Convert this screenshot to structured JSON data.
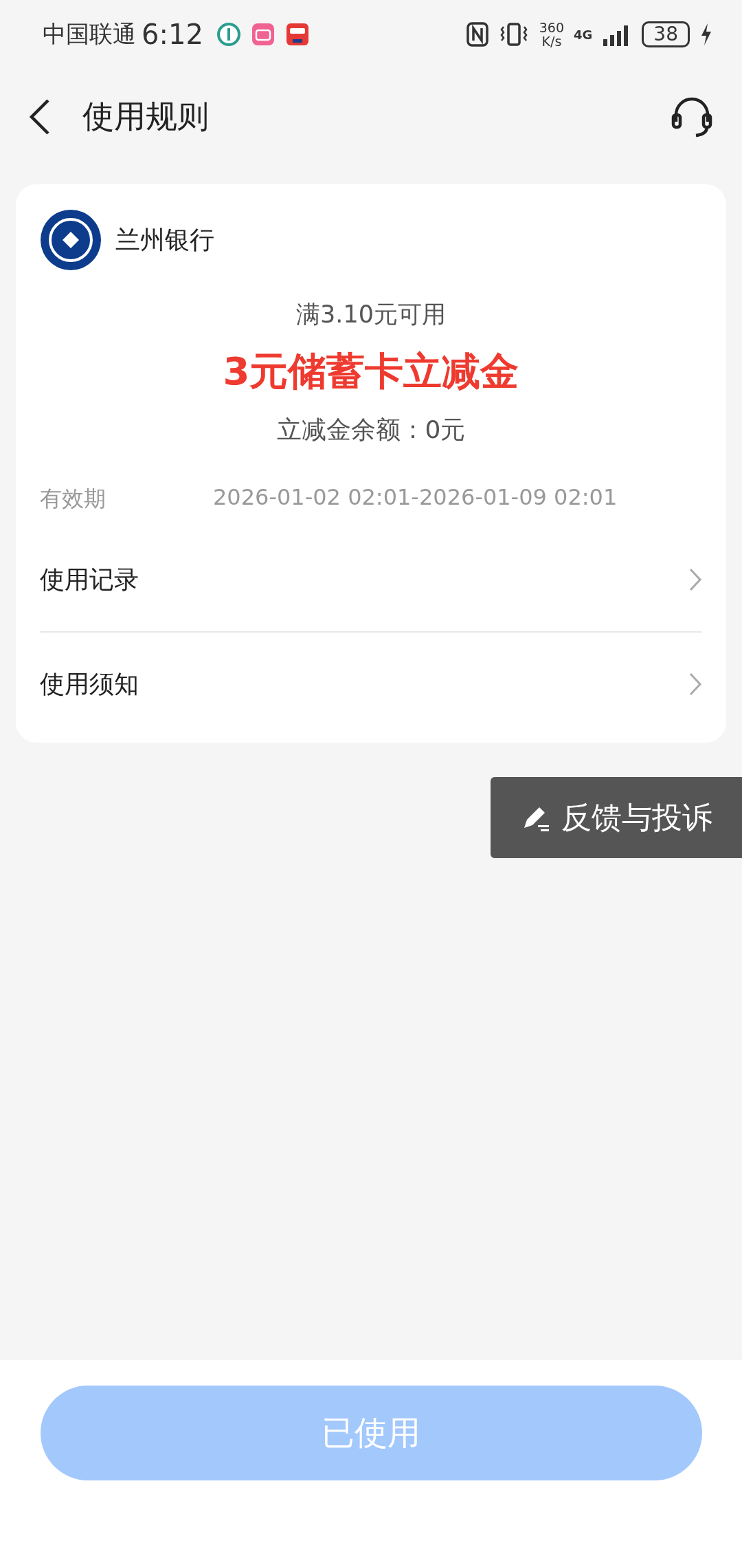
{
  "status_bar": {
    "carrier": "中国联通",
    "time": "6:12",
    "speed_value": "360",
    "speed_unit": "K/s",
    "network": "4G",
    "battery": "38"
  },
  "header": {
    "title": "使用规则"
  },
  "card": {
    "bank_name": "兰州银行",
    "condition": "满3.10元可用",
    "title": "3元储蓄卡立减金",
    "balance": "立减金余额：0元",
    "validity": {
      "label": "有效期",
      "value": "2026-01-02 02:01-2026-01-09 02:01"
    },
    "links": [
      {
        "label": "使用记录"
      },
      {
        "label": "使用须知"
      }
    ]
  },
  "feedback_button": {
    "label": "反馈与投诉"
  },
  "bottom_button": {
    "label": "已使用",
    "disabled": true
  }
}
